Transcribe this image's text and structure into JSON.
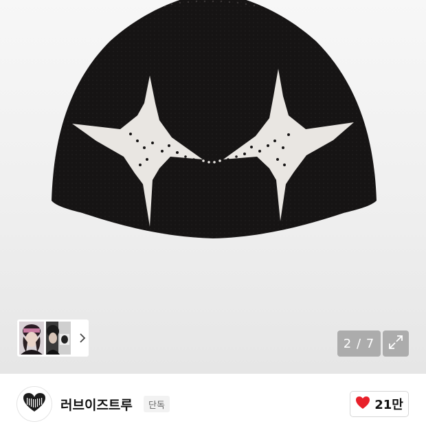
{
  "gallery": {
    "counter": "2 / 7",
    "icons": {
      "next": "chevron-right-icon",
      "expand": "expand-icon"
    }
  },
  "brand": {
    "name": "러브이즈트루",
    "badge": "단독",
    "logo_icon": "heart-logo-icon"
  },
  "like": {
    "count": "21만",
    "icon": "heart-icon",
    "color": "#e8202a"
  }
}
